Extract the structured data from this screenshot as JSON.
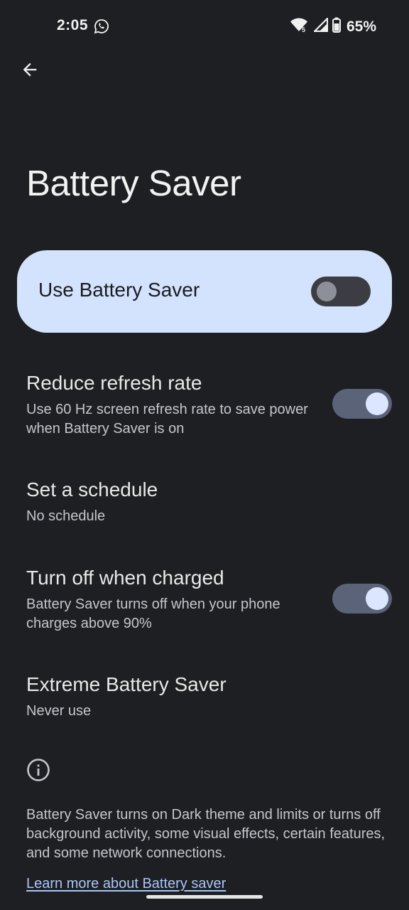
{
  "status_bar": {
    "time": "2:05",
    "battery_percent": "65%",
    "wifi_badge": "5",
    "icons": [
      "whatsapp-icon",
      "wifi-icon",
      "signal-icon",
      "battery-icon"
    ]
  },
  "header": {
    "back_icon": "arrow-left-icon",
    "title": "Battery Saver"
  },
  "main_switch": {
    "label": "Use Battery Saver",
    "checked": false,
    "card_color": "#d3e3fd"
  },
  "settings": [
    {
      "title": "Reduce refresh rate",
      "summary": "Use 60 Hz screen refresh rate to save power when Battery Saver is on",
      "has_toggle": true,
      "checked": true
    },
    {
      "title": "Set a schedule",
      "summary": "No schedule",
      "has_toggle": false
    },
    {
      "title": "Turn off when charged",
      "summary": "Battery Saver turns off when your phone charges above 90%",
      "has_toggle": true,
      "checked": true
    },
    {
      "title": "Extreme Battery Saver",
      "summary": "Never use",
      "has_toggle": false
    }
  ],
  "footer": {
    "info_icon": "info-icon",
    "text": "Battery Saver turns on Dark theme and limits or turns off background activity, some visual effects, certain features, and some network connections.",
    "link": "Learn more about Battery saver"
  },
  "colors": {
    "background": "#1e1f22",
    "accent_link": "#a8c7fa",
    "toggle_on_track": "#5b6379",
    "toggle_on_thumb": "#dce6ff"
  }
}
